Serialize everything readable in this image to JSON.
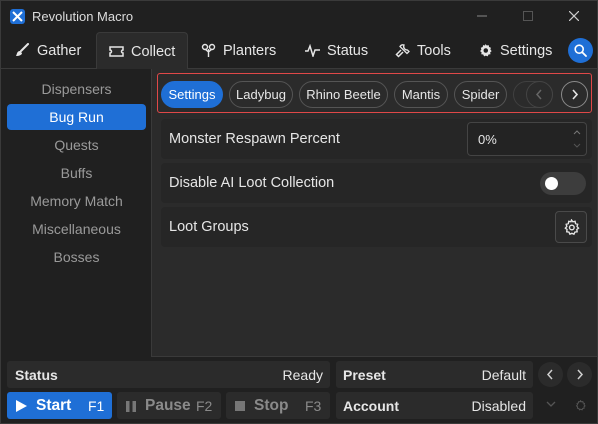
{
  "app": {
    "title": "Revolution Macro"
  },
  "tabs": [
    {
      "label": "Gather",
      "icon": "brush-icon"
    },
    {
      "label": "Collect",
      "icon": "ticket-icon",
      "active": true
    },
    {
      "label": "Planters",
      "icon": "planter-icon"
    },
    {
      "label": "Status",
      "icon": "pulse-icon"
    },
    {
      "label": "Tools",
      "icon": "wrench-icon"
    },
    {
      "label": "Settings",
      "icon": "gear-icon"
    }
  ],
  "sidebar": {
    "items": [
      {
        "label": "Dispensers"
      },
      {
        "label": "Bug Run",
        "active": true
      },
      {
        "label": "Quests"
      },
      {
        "label": "Buffs"
      },
      {
        "label": "Memory Match"
      },
      {
        "label": "Miscellaneous"
      },
      {
        "label": "Bosses"
      }
    ]
  },
  "subtabs": [
    {
      "label": "Settings",
      "active": true
    },
    {
      "label": "Ladybug"
    },
    {
      "label": "Rhino Beetle"
    },
    {
      "label": "Mantis"
    },
    {
      "label": "Spider"
    }
  ],
  "settings": {
    "respawn": {
      "label": "Monster Respawn Percent",
      "value": "0%"
    },
    "disable_ai": {
      "label": "Disable AI Loot Collection",
      "enabled": false
    },
    "loot_groups": {
      "label": "Loot Groups"
    }
  },
  "bottom": {
    "status_label": "Status",
    "status_value": "Ready",
    "preset_label": "Preset",
    "preset_value": "Default",
    "account_label": "Account",
    "account_value": "Disabled",
    "start_label": "Start",
    "start_key": "F1",
    "pause_label": "Pause",
    "pause_key": "F2",
    "stop_label": "Stop",
    "stop_key": "F3"
  },
  "colors": {
    "accent": "#1f6fd6",
    "highlight_border": "#e04848",
    "background": "#202020",
    "panel": "#2b2b2b"
  }
}
